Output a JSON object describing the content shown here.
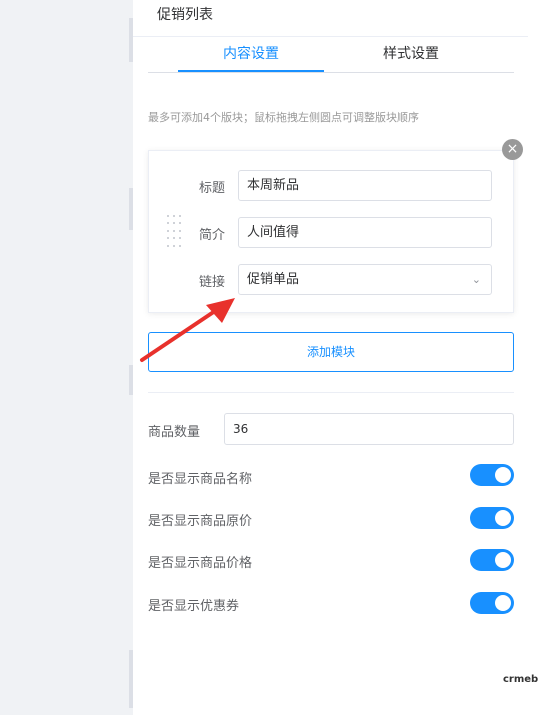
{
  "panel": {
    "title": "促销列表",
    "tabs": [
      {
        "label": "内容设置",
        "active": true
      },
      {
        "label": "样式设置",
        "active": false
      }
    ],
    "hint": "最多可添加4个版块；鼠标拖拽左侧圆点可调整版块顺序"
  },
  "card": {
    "title_label": "标题",
    "title_value": "本周新品",
    "intro_label": "简介",
    "intro_value": "人间值得",
    "link_label": "链接",
    "link_value": "促销单品",
    "close_icon": "×"
  },
  "add_module_label": "添加模块",
  "quantity": {
    "label": "商品数量",
    "value": "36"
  },
  "switches": [
    {
      "label": "是否显示商品名称",
      "on": true
    },
    {
      "label": "是否显示商品原价",
      "on": true
    },
    {
      "label": "是否显示商品价格",
      "on": true
    },
    {
      "label": "是否显示优惠券",
      "on": true
    }
  ],
  "watermark": "crmeb",
  "colors": {
    "accent": "#1890ff",
    "arrow": "#e8312c"
  }
}
